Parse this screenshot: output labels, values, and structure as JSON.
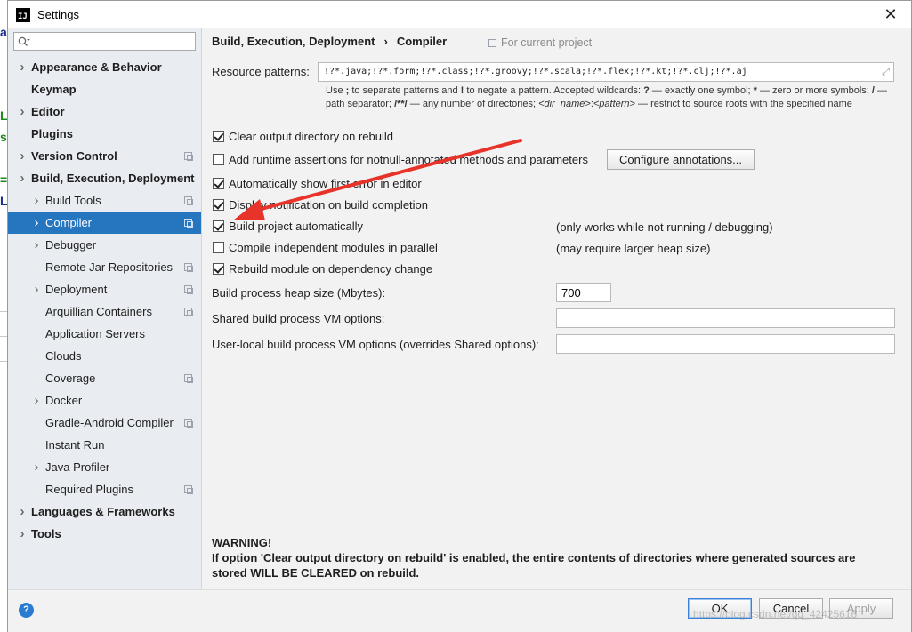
{
  "window": {
    "title": "Settings"
  },
  "background": {
    "letters": [
      "a",
      "L",
      "s",
      "=",
      "L"
    ]
  },
  "search": {
    "value": "",
    "placeholder": ""
  },
  "sidebar": {
    "items": [
      {
        "label": "Appearance & Behavior",
        "level": "top",
        "arrow": true
      },
      {
        "label": "Keymap",
        "level": "top",
        "arrow": false
      },
      {
        "label": "Editor",
        "level": "top",
        "arrow": true
      },
      {
        "label": "Plugins",
        "level": "top",
        "arrow": false
      },
      {
        "label": "Version Control",
        "level": "top",
        "arrow": true
      },
      {
        "label": "Build, Execution, Deployment",
        "level": "top",
        "arrow": true
      },
      {
        "label": "Build Tools",
        "level": "child",
        "arrow": true
      },
      {
        "label": "Compiler",
        "level": "child",
        "arrow": true
      },
      {
        "label": "Debugger",
        "level": "child",
        "arrow": true
      },
      {
        "label": "Remote Jar Repositories",
        "level": "child",
        "arrow": false
      },
      {
        "label": "Deployment",
        "level": "child",
        "arrow": true
      },
      {
        "label": "Arquillian Containers",
        "level": "child",
        "arrow": false
      },
      {
        "label": "Application Servers",
        "level": "child",
        "arrow": false
      },
      {
        "label": "Clouds",
        "level": "child",
        "arrow": false
      },
      {
        "label": "Coverage",
        "level": "child",
        "arrow": false
      },
      {
        "label": "Docker",
        "level": "child",
        "arrow": true
      },
      {
        "label": "Gradle-Android Compiler",
        "level": "child",
        "arrow": false
      },
      {
        "label": "Instant Run",
        "level": "child",
        "arrow": false
      },
      {
        "label": "Java Profiler",
        "level": "child",
        "arrow": true
      },
      {
        "label": "Required Plugins",
        "level": "child",
        "arrow": false
      },
      {
        "label": "Languages & Frameworks",
        "level": "top",
        "arrow": true
      },
      {
        "label": "Tools",
        "level": "top",
        "arrow": true
      }
    ]
  },
  "breadcrumb": {
    "parent": "Build, Execution, Deployment",
    "separator": "›",
    "current": "Compiler"
  },
  "scope": {
    "label": "For current project"
  },
  "resource": {
    "label": "Resource patterns:",
    "value": "!?*.java;!?*.form;!?*.class;!?*.groovy;!?*.scala;!?*.flex;!?*.kt;!?*.clj;!?*.aj"
  },
  "hint": {
    "p1": "Use ",
    "b1": ";",
    "p2": " to separate patterns and ",
    "b2": "!",
    "p3": " to negate a pattern. Accepted wildcards: ",
    "b3": "?",
    "p4": " — exactly one symbol; ",
    "b4": "*",
    "p5": " — zero or more symbols; ",
    "b5": "/",
    "p6": " — path separator; ",
    "b6": "/**/",
    "p7": " — any number of directories; ",
    "i1": "<dir_name>",
    "p8": ":",
    "i2": "<pattern>",
    "p9": " — restrict to source roots with the specified name"
  },
  "options": {
    "clear_output": {
      "label": "Clear output directory on rebuild",
      "checked": true
    },
    "runtime_assertions": {
      "label": "Add runtime assertions for notnull-annotated methods and parameters",
      "checked": false
    },
    "configure_annotations": {
      "label": "Configure annotations..."
    },
    "show_first_error": {
      "label": "Automatically show first error in editor",
      "checked": true
    },
    "display_notification": {
      "label": "Display notification on build completion",
      "checked": true
    },
    "build_auto": {
      "label": "Build project automatically",
      "checked": true,
      "note": "(only works while not running / debugging)"
    },
    "compile_parallel": {
      "label": "Compile independent modules in parallel",
      "checked": false,
      "note": "(may require larger heap size)"
    },
    "rebuild_dependency": {
      "label": "Rebuild module on dependency change",
      "checked": true
    }
  },
  "fields": {
    "heap": {
      "label": "Build process heap size (Mbytes):",
      "value": "700"
    },
    "shared_vm": {
      "label": "Shared build process VM options:",
      "value": ""
    },
    "user_vm": {
      "label": "User-local build process VM options (overrides Shared options):",
      "value": ""
    }
  },
  "warning": {
    "title": "WARNING!",
    "text": "If option 'Clear output directory on rebuild' is enabled, the entire contents of directories where generated sources are stored WILL BE CLEARED on rebuild."
  },
  "buttons": {
    "help": "?",
    "ok": "OK",
    "cancel": "Cancel",
    "apply": "Apply"
  },
  "watermark": {
    "text": "https://blog.csdn.net/qq_42425616"
  },
  "colors": {
    "selection": "#2675bf",
    "annotation": "#e8332a"
  },
  "icons": {
    "search": "search-icon",
    "copy": "project-scope-icon",
    "expand": "expand-icon",
    "close": "close-icon",
    "help": "help-icon"
  }
}
